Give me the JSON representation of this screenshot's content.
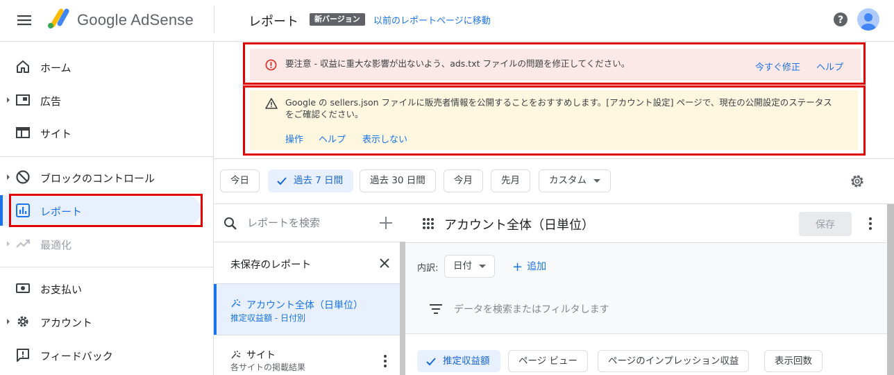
{
  "header": {
    "brand": "Google AdSense",
    "page_title": "レポート",
    "badge": "新バージョン",
    "old_report_link": "以前のレポートページに移動"
  },
  "sidebar": {
    "items": [
      {
        "label": "ホーム",
        "icon": "home-icon"
      },
      {
        "label": "広告",
        "icon": "ads-icon"
      },
      {
        "label": "サイト",
        "icon": "sites-icon"
      },
      {
        "label": "ブロックのコントロール",
        "icon": "block-icon"
      },
      {
        "label": "レポート",
        "icon": "reports-icon"
      },
      {
        "label": "最適化",
        "icon": "optimize-icon"
      },
      {
        "label": "お支払い",
        "icon": "payments-icon"
      },
      {
        "label": "アカウント",
        "icon": "account-gear-icon"
      },
      {
        "label": "フィードバック",
        "icon": "feedback-icon"
      }
    ]
  },
  "alerts": {
    "error": {
      "text": "要注意 - 収益に重大な影響が出ないよう、ads.txt ファイルの問題を修正してください。",
      "fix_now": "今すぐ修正",
      "help": "ヘルプ"
    },
    "warning": {
      "text_line1": "Google の sellers.json ファイルに販売者情報を公開することをおすすめします。[アカウント設定] ページで、現在の公開設定のステータス",
      "text_line2": "をご確認ください。",
      "action": "操作",
      "help": "ヘルプ",
      "dismiss": "表示しない"
    }
  },
  "date_range": {
    "chips": [
      "今日",
      "過去 7 日間",
      "過去 30 日間",
      "今月",
      "先月",
      "カスタム"
    ],
    "selected": "過去 7 日間"
  },
  "report_list": {
    "search_placeholder": "レポートを検索",
    "unsaved_title": "未保存のレポート",
    "items": [
      {
        "title": "アカウント全体（日単位）",
        "subtitle": "推定収益額 - 日付別"
      },
      {
        "title": "サイト",
        "subtitle": "各サイトの掲載結果"
      }
    ]
  },
  "report": {
    "title": "アカウント全体（日単位）",
    "save_label": "保存",
    "breakdown_label": "内訳:",
    "breakdown_value": "日付",
    "add_label": "追加",
    "filter_placeholder": "データを検索またはフィルタします",
    "metrics": [
      "推定収益額",
      "ページ ビュー",
      "ページのインプレッション収益",
      "表示回数"
    ]
  },
  "colors": {
    "accent": "#1a73e8",
    "error_bg": "#fce8e6",
    "warning_bg": "#fef7e0",
    "highlight_box": "#e00000"
  }
}
